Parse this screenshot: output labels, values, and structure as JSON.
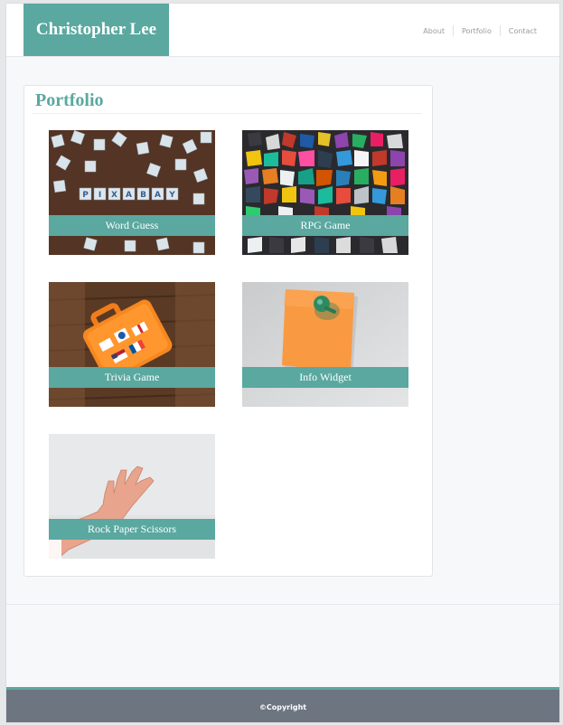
{
  "header": {
    "brand": "Christopher Lee",
    "nav": [
      {
        "label": "About"
      },
      {
        "label": "Portfolio"
      },
      {
        "label": "Contact"
      }
    ]
  },
  "portfolio": {
    "title": "Portfolio",
    "items": [
      {
        "label": "Word Guess",
        "image": "scrabble-tiles"
      },
      {
        "label": "RPG Game",
        "image": "dice-pile"
      },
      {
        "label": "Trivia Game",
        "image": "orange-suitcase-toy"
      },
      {
        "label": "Info Widget",
        "image": "sticky-note-pin"
      },
      {
        "label": "Rock Paper Scissors",
        "image": "raised-hand"
      }
    ]
  },
  "footer": {
    "text": "©Copyright"
  },
  "colors": {
    "accent": "#5aa8a0",
    "footer": "#6c7580",
    "background": "#f7f8fa"
  }
}
